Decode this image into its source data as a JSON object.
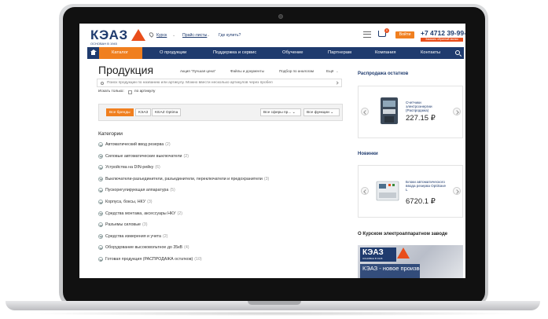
{
  "header": {
    "logo_text": "КЭАЗ",
    "logo_sub": "ОСНОВАН В 1945",
    "city": "Курск",
    "price_lists": "Прайс-листы",
    "where_to_buy": "Где купить?",
    "cart_count": "0",
    "login_label": "Войти",
    "phone": "+7 4712 39-99-11",
    "callback_label": "Заказать обратный звонок"
  },
  "nav": {
    "items": [
      "Каталог",
      "О продукции",
      "Поддержка и сервис",
      "Обучение",
      "Партнерам",
      "Компания",
      "Контакты"
    ]
  },
  "main": {
    "title": "Продукция",
    "quick_links": [
      "Акция \"Лучшая цена\"",
      "Файлы и документы",
      "Подбор по аналогам",
      "Ещё"
    ],
    "search_placeholder": "Поиск продукции по названию или артикулу. Можно ввести несколько артикулов через пробел",
    "search_only_label": "Искать только:",
    "search_only_option": "по артикулу",
    "brand_tabs": [
      "Все бренды",
      "КЭАЗ",
      "KEAZ Optima"
    ],
    "filter_spheres": "Все сферы пр...",
    "filter_functions": "Все функции",
    "categories_title": "Категории",
    "categories": [
      {
        "name": "Автоматический ввод резерва",
        "count": "(2)"
      },
      {
        "name": "Силовые автоматические выключатели",
        "count": "(2)"
      },
      {
        "name": "Устройства на DIN-рейку",
        "count": "(6)"
      },
      {
        "name": "Выключатели-разъединители, разъединители, переключатели и предохранители",
        "count": "(3)"
      },
      {
        "name": "Пускорегулирующая аппаратура",
        "count": "(5)"
      },
      {
        "name": "Корпуса, боксы, НКУ",
        "count": "(3)"
      },
      {
        "name": "Средства монтажа, аксессуары НКУ",
        "count": "(2)"
      },
      {
        "name": "Разъемы силовые",
        "count": "(3)"
      },
      {
        "name": "Средства измерения и учета",
        "count": "(2)"
      },
      {
        "name": "Оборудование высоковольтное до 35кВ",
        "count": "(4)"
      },
      {
        "name": "Готовая продукция (РАСПРОДАЖА остатков)",
        "count": "(10)"
      }
    ]
  },
  "sidebar": {
    "sale_title": "Распродажа остатков",
    "sale_product_name": "Счетчики электроэнергии (Распродажа)",
    "sale_price": "227.15 ₽",
    "new_title": "Новинки",
    "new_product_name": "Блоки автоматического ввода резерва OptiSave L",
    "new_price": "6720.1 ₽",
    "plant_title": "О Курском электроаппаратном заводе",
    "plant_logo_text": "КЭАЗ",
    "plant_logo_sub": "ОСНОВАН В 1945",
    "plant_caption": "КЭАЗ - новое производство"
  },
  "colors": {
    "brand_blue": "#1f3b6e",
    "accent_orange": "#f07f1f",
    "logo_red": "#e94e1b"
  }
}
